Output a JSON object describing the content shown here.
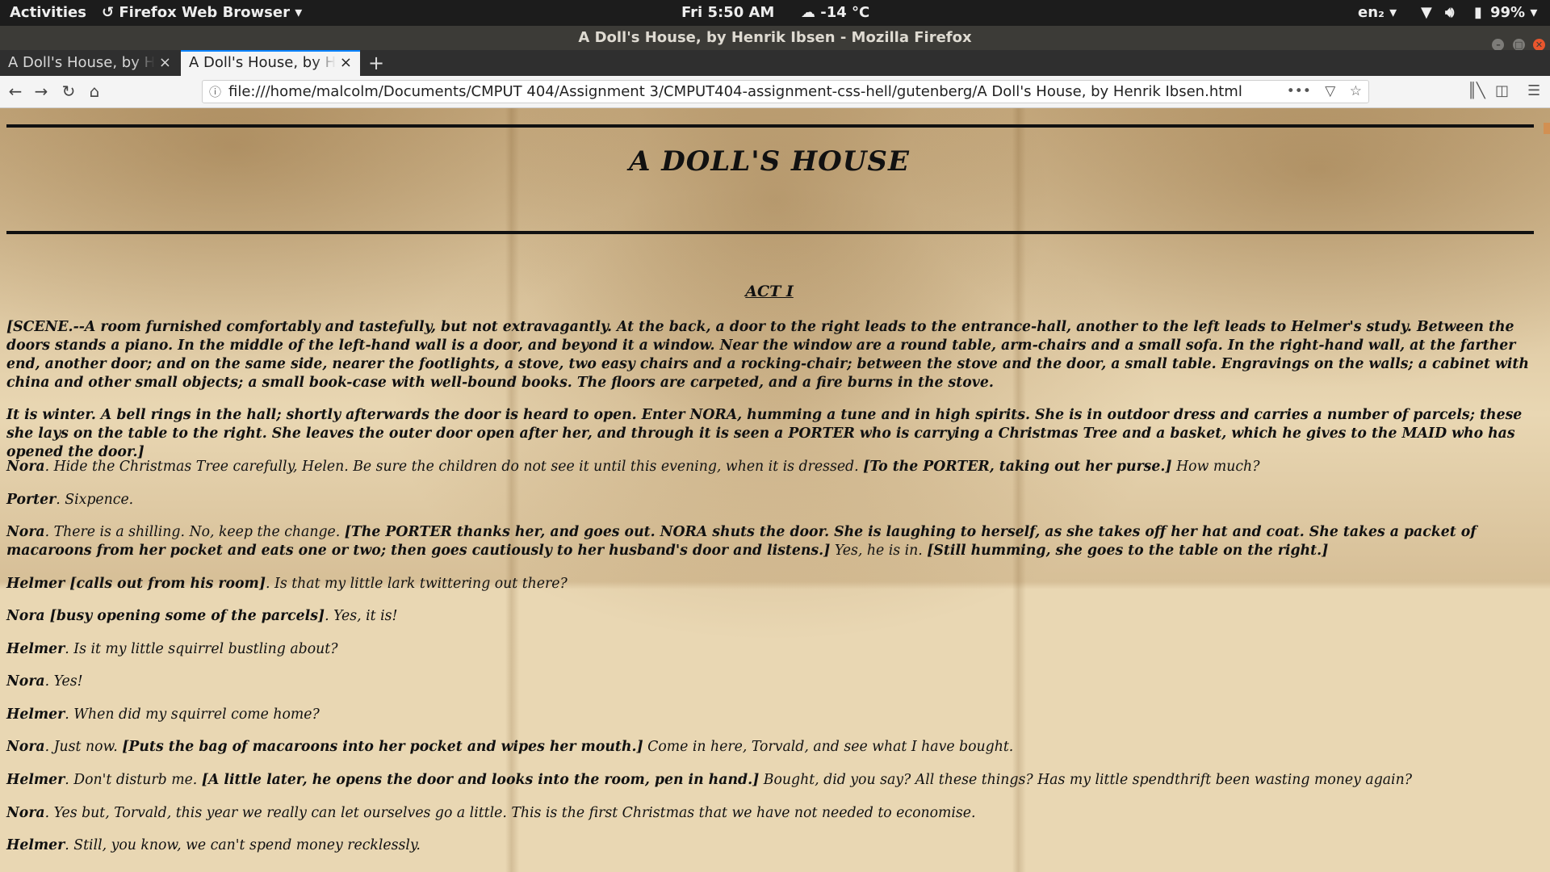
{
  "topbar": {
    "activities": "Activities",
    "app_menu": "Firefox Web Browser ▾",
    "clock": "Fri   5:50 AM",
    "weather": "☁ -14 °C",
    "keyboard": "en₂ ▾",
    "battery": "99% ▾"
  },
  "window": {
    "title": "A Doll's House, by Henrik Ibsen - Mozilla Firefox"
  },
  "tabs": [
    {
      "label": "A Doll's House, by Henrik Ibsen",
      "close": "×"
    },
    {
      "label": "A Doll's House, by Henrik Ibsen",
      "close": "×"
    }
  ],
  "newtab": "+",
  "nav": {
    "url": "file:///home/malcolm/Documents/CMPUT 404/Assignment 3/CMPUT404-assignment-css-hell/gutenberg/A Doll's House, by Henrik Ibsen.html",
    "page_actions": "•••"
  },
  "page": {
    "title": "A DOLL'S HOUSE",
    "act": "ACT I",
    "scene": "[SCENE.--A room furnished comfortably and tastefully, but not extravagantly. At the back, a door to the right leads to the entrance-hall, another to the left leads to Helmer's study. Between the doors stands a piano. In the middle of the left-hand wall is a door, and beyond it a window. Near the window are a round table, arm-chairs and a small sofa. In the right-hand wall, at the farther end, another door; and on the same side, nearer the footlights, a stove, two easy chairs and a rocking-chair; between the stove and the door, a small table. Engravings on the walls; a cabinet with china and other small objects; a small book-case with well-bound books. The floors are carpeted, and a fire burns in the stove.",
    "scene2": "It is winter. A bell rings in the hall; shortly afterwards the door is heard to open. Enter NORA, humming a tune and in high spirits. She is in outdoor dress and carries a number of parcels; these she lays on the table to the right. She leaves the outer door open after her, and through it is seen a PORTER who is carrying a Christmas Tree and a basket, which he gives to the MAID who has opened the door.]",
    "lines": [
      {
        "speaker": "Nora",
        "a": ". Hide the Christmas Tree carefully, Helen. Be sure the children do not see it until this evening, when it is dressed. ",
        "dir": "[To the PORTER, taking out her purse.]",
        "b": " How much?"
      },
      {
        "speaker": "Porter",
        "a": ". Sixpence.",
        "dir": "",
        "b": ""
      },
      {
        "speaker": "Nora",
        "a": ". There is a shilling. No, keep the change. ",
        "dir": "[The PORTER thanks her, and goes out. NORA shuts the door. She is laughing to herself, as she takes off her hat and coat. She takes a packet of macaroons from her pocket and eats one or two; then goes cautiously to her husband's door and listens.]",
        "b": " Yes, he is in. ",
        "dir2": "[Still humming, she goes to the table on the right.]"
      },
      {
        "speaker": "Helmer [calls out from his room]",
        "a": ". Is that my little lark twittering out there?",
        "dir": "",
        "b": ""
      },
      {
        "speaker": "Nora [busy opening some of the parcels]",
        "a": ". Yes, it is!",
        "dir": "",
        "b": ""
      },
      {
        "speaker": "Helmer",
        "a": ". Is it my little squirrel bustling about?",
        "dir": "",
        "b": ""
      },
      {
        "speaker": "Nora",
        "a": ". Yes!",
        "dir": "",
        "b": ""
      },
      {
        "speaker": "Helmer",
        "a": ". When did my squirrel come home?",
        "dir": "",
        "b": ""
      },
      {
        "speaker": "Nora",
        "a": ". Just now. ",
        "dir": "[Puts the bag of macaroons into her pocket and wipes her mouth.]",
        "b": " Come in here, Torvald, and see what I have bought."
      },
      {
        "speaker": "Helmer",
        "a": ". Don't disturb me. ",
        "dir": "[A little later, he opens the door and looks into the room, pen in hand.]",
        "b": " Bought, did you say? All these things? Has my little spendthrift been wasting money again?"
      },
      {
        "speaker": "Nora",
        "a": ". Yes but, Torvald, this year we really can let ourselves go a little. This is the first Christmas that we have not needed to economise.",
        "dir": "",
        "b": ""
      },
      {
        "speaker": "Helmer",
        "a": ". Still, you know, we can't spend money recklessly.",
        "dir": "",
        "b": ""
      }
    ]
  }
}
